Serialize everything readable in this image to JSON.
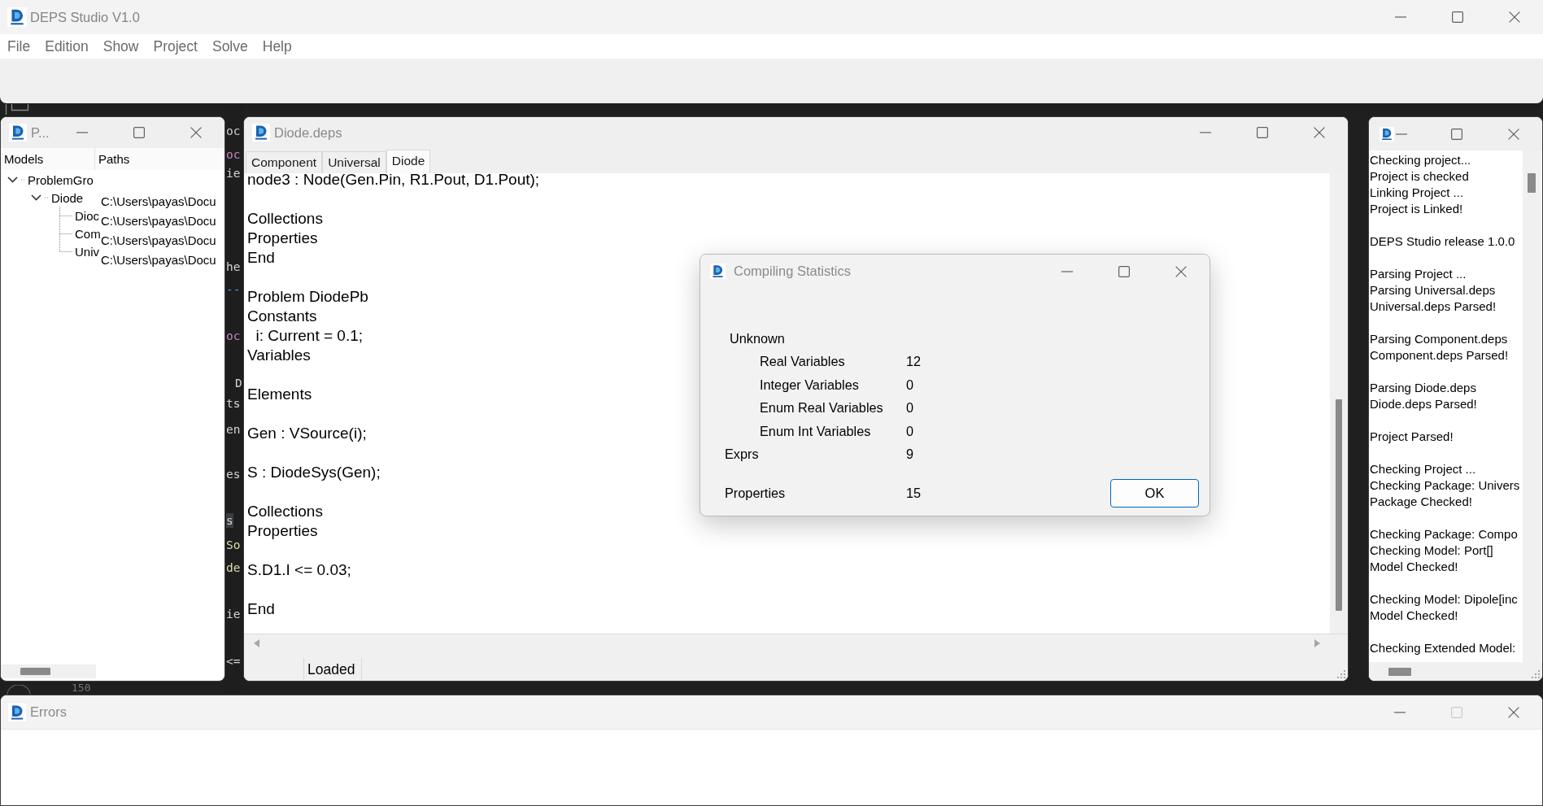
{
  "main_window": {
    "title": "DEPS Studio V1.0",
    "maximize_disabled": false,
    "menu": [
      "File",
      "Edition",
      "Show",
      "Project",
      "Solve",
      "Help"
    ]
  },
  "background_code": [
    {
      "text": "oc",
      "kind": "title"
    },
    {
      "text": "oc",
      "kind": "keyword"
    },
    {
      "text": "ie",
      "kind": "plain"
    },
    {
      "text": "he",
      "kind": "plain"
    },
    {
      "text": "--",
      "kind": "operator"
    },
    {
      "text": "oc",
      "kind": "keyword"
    },
    {
      "text": "D",
      "kind": "plain"
    },
    {
      "text": "ts",
      "kind": "plain"
    },
    {
      "text": "en",
      "kind": "plain"
    },
    {
      "text": "es",
      "kind": "plain"
    },
    {
      "text": "s",
      "kind": "highlight"
    },
    {
      "text": "So",
      "kind": "function"
    },
    {
      "text": "de",
      "kind": "function"
    },
    {
      "text": "ie",
      "kind": "plain"
    },
    {
      "text": "<=",
      "kind": "plain"
    }
  ],
  "line_number": "150",
  "project_window": {
    "title": "P...",
    "maximize_disabled": false,
    "columns": [
      "Models",
      "Paths"
    ],
    "tree": [
      {
        "label": "ProblemGro",
        "expanded": true,
        "children": [
          {
            "label": "Diode",
            "expanded": true,
            "path": "C:\\Users\\payas\\Docu",
            "children": [
              {
                "label": "Dioc",
                "path": "C:\\Users\\payas\\Docu"
              },
              {
                "label": "Com",
                "path": "C:\\Users\\payas\\Docu"
              },
              {
                "label": "Univ",
                "path": "C:\\Users\\payas\\Docu"
              }
            ]
          }
        ]
      }
    ]
  },
  "editor_window": {
    "title": "Diode.deps",
    "maximize_disabled": false,
    "tabs": [
      {
        "label": "Component",
        "selected": false
      },
      {
        "label": "Universal",
        "selected": false
      },
      {
        "label": "Diode",
        "selected": true
      }
    ],
    "code_blocks": [
      [
        "node3 : Node(Gen.Pin, R1.Pout, D1.Pout);"
      ],
      [
        "Collections",
        "Properties",
        "End"
      ],
      [
        "Problem DiodePb",
        "Constants",
        "  i: Current = 0.1;",
        "Variables"
      ],
      [
        "Elements"
      ],
      [
        "Gen : VSource(i);"
      ],
      [
        "S : DiodeSys(Gen);"
      ],
      [
        "Collections",
        "Properties"
      ],
      [
        "S.D1.I <= 0.03;"
      ],
      [
        "End"
      ]
    ],
    "status_bar": [
      "Loaded"
    ]
  },
  "dialog": {
    "title": "Compiling Statistics",
    "maximize_disabled": false,
    "heading": "Unknown",
    "unknown_rows": [
      {
        "label": "Real Variables",
        "value": "12"
      },
      {
        "label": "Integer Variables",
        "value": "0"
      },
      {
        "label": "Enum Real Variables",
        "value": "0"
      },
      {
        "label": "Enum Int Variables",
        "value": "0"
      }
    ],
    "rows": [
      {
        "label": "Exprs",
        "value": "9"
      },
      {
        "label": "Properties",
        "value": "15"
      }
    ],
    "buttons": [
      "OK"
    ]
  },
  "output_window": {
    "maximize_disabled": false,
    "log_groups": [
      [
        "Checking project...",
        "Project is checked",
        "Linking Project ...",
        "Project is Linked!"
      ],
      [
        "DEPS Studio release 1.0.0"
      ],
      [
        "Parsing Project ...",
        "Parsing Universal.deps",
        "Universal.deps Parsed!"
      ],
      [
        "Parsing Component.deps",
        "Component.deps Parsed!"
      ],
      [
        "Parsing Diode.deps",
        "Diode.deps Parsed!"
      ],
      [
        "Project Parsed!"
      ],
      [
        "Checking Project ...",
        "Checking Package: Univers",
        "Package Checked!"
      ],
      [
        "Checking Package: Compo",
        "Checking Model: Port[]",
        "Model Checked!"
      ],
      [
        "Checking Model: Dipole[inc",
        "Model Checked!"
      ],
      [
        "Checking Extended Model:"
      ]
    ]
  },
  "errors_window": {
    "title": "Errors",
    "maximize_disabled": true
  }
}
